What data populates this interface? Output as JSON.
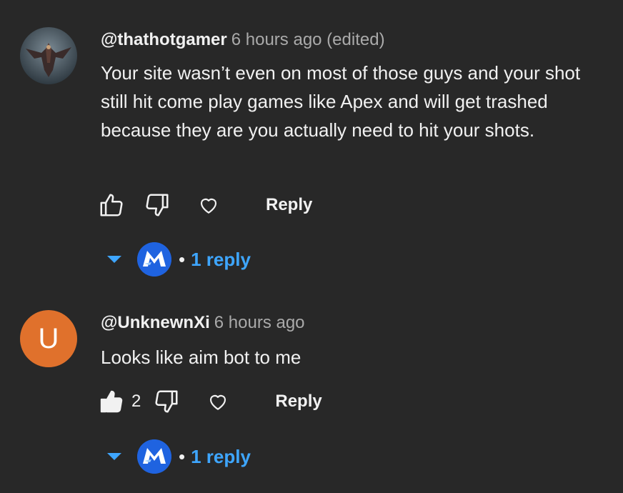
{
  "comments": [
    {
      "handle": "@thathotgamer",
      "time": "6 hours ago (edited)",
      "text": "Your site wasn’t even on most of those guys and your shot still hit come play games like Apex and will get trashed because they are you actually need to hit your shots.",
      "like_count": "",
      "reply_label": "Reply",
      "replies_label": "1 reply",
      "avatar_icon": "dark-fantasy-creature-avatar"
    },
    {
      "handle": "@UnknewnXi",
      "time": "6 hours ago",
      "text": "Looks like aim bot to me",
      "like_count": "2",
      "avatar_letter": "U",
      "reply_label": "Reply",
      "replies_label": "1 reply"
    }
  ],
  "separator": "•",
  "colors": {
    "background": "#282828",
    "link_blue": "#3ea6ff",
    "avatar_orange": "#e0712c",
    "creator_avatar_blue": "#1f63e0"
  },
  "icons": [
    "thumbs-up-icon",
    "thumbs-down-icon",
    "heart-icon",
    "caret-down-icon"
  ]
}
